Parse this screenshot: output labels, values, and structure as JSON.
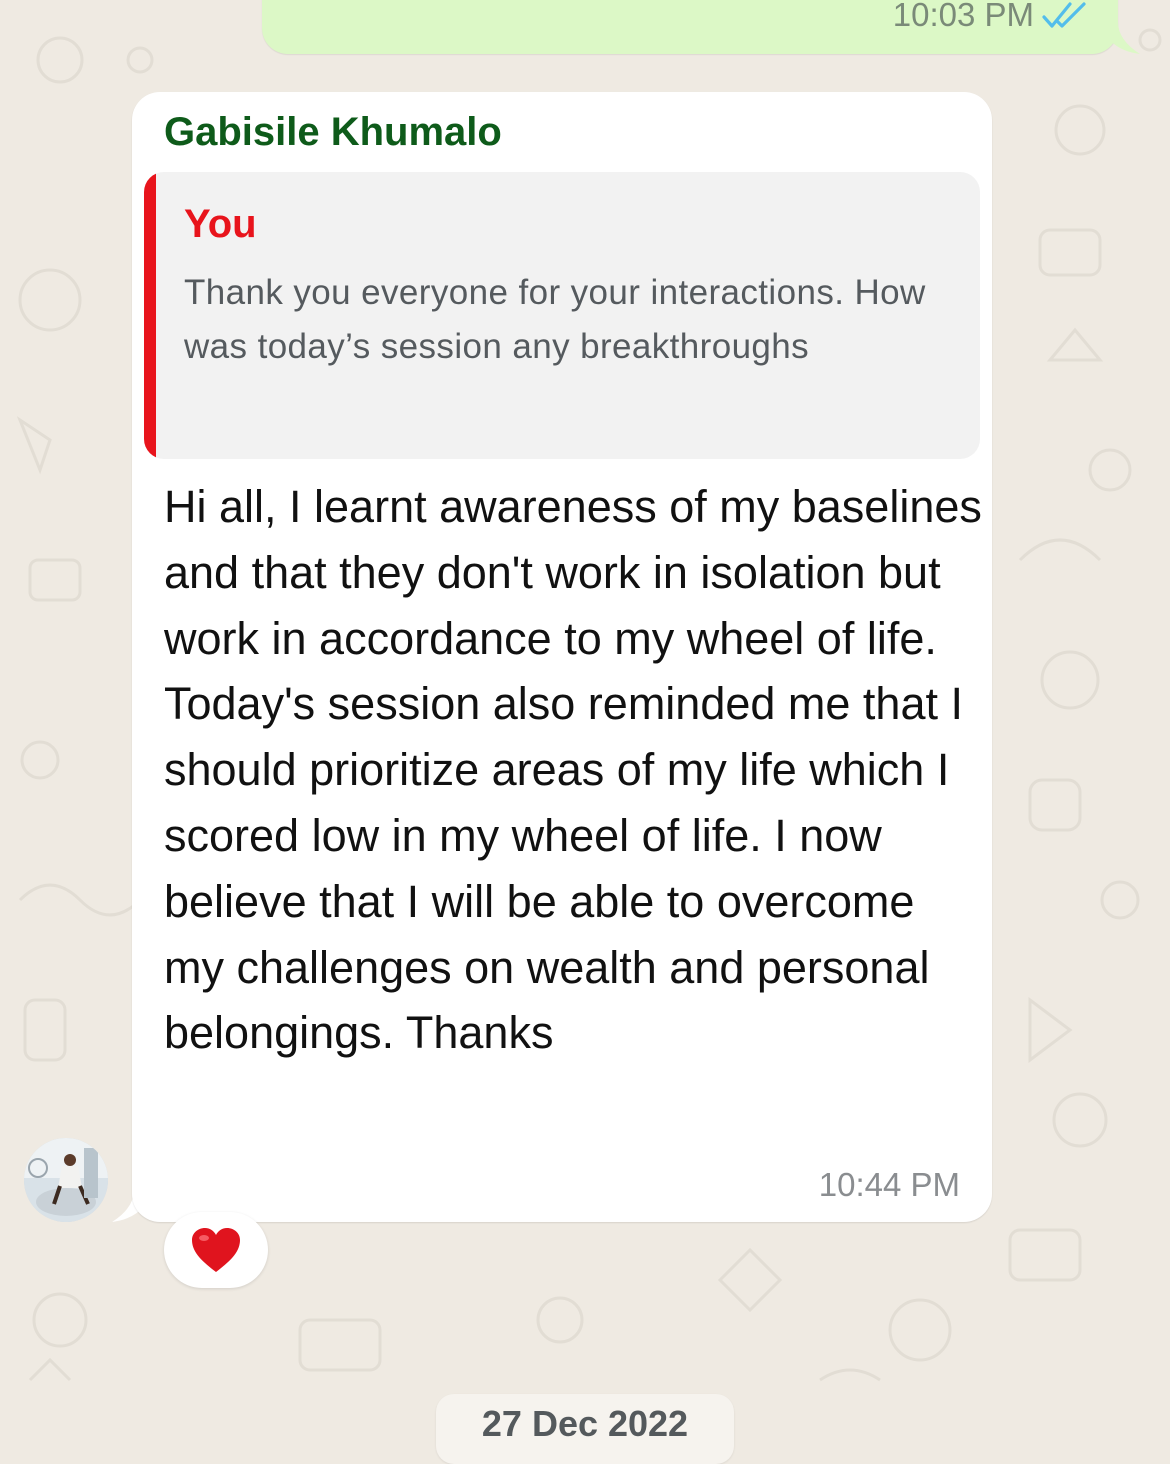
{
  "outgoing": {
    "time": "10:03 PM",
    "status_icon": "double-check-icon",
    "status_color": "#53bdeb"
  },
  "incoming": {
    "sender": "Gabisile Khumalo",
    "sender_color": "#0e5b1a",
    "quoted": {
      "author": "You",
      "author_color": "#e8141c",
      "text": "Thank you everyone for your interactions. How was today’s session any breakthroughs"
    },
    "text": "Hi all, I learnt awareness of my baselines and that they don't work in isolation but work in accordance to my wheel of life. Today's session also reminded me that I should prioritize areas of my life which I scored low in my wheel of life. I now believe that I will be able to overcome my challenges on wealth and personal belongings. Thanks",
    "time": "10:44 PM",
    "reaction": "❤️",
    "avatar_icon": "avatar"
  },
  "date_separator": "27 Dec 2022",
  "colors": {
    "background": "#efeae2",
    "outgoing_bubble": "#dcf8c6",
    "incoming_bubble": "#ffffff"
  }
}
